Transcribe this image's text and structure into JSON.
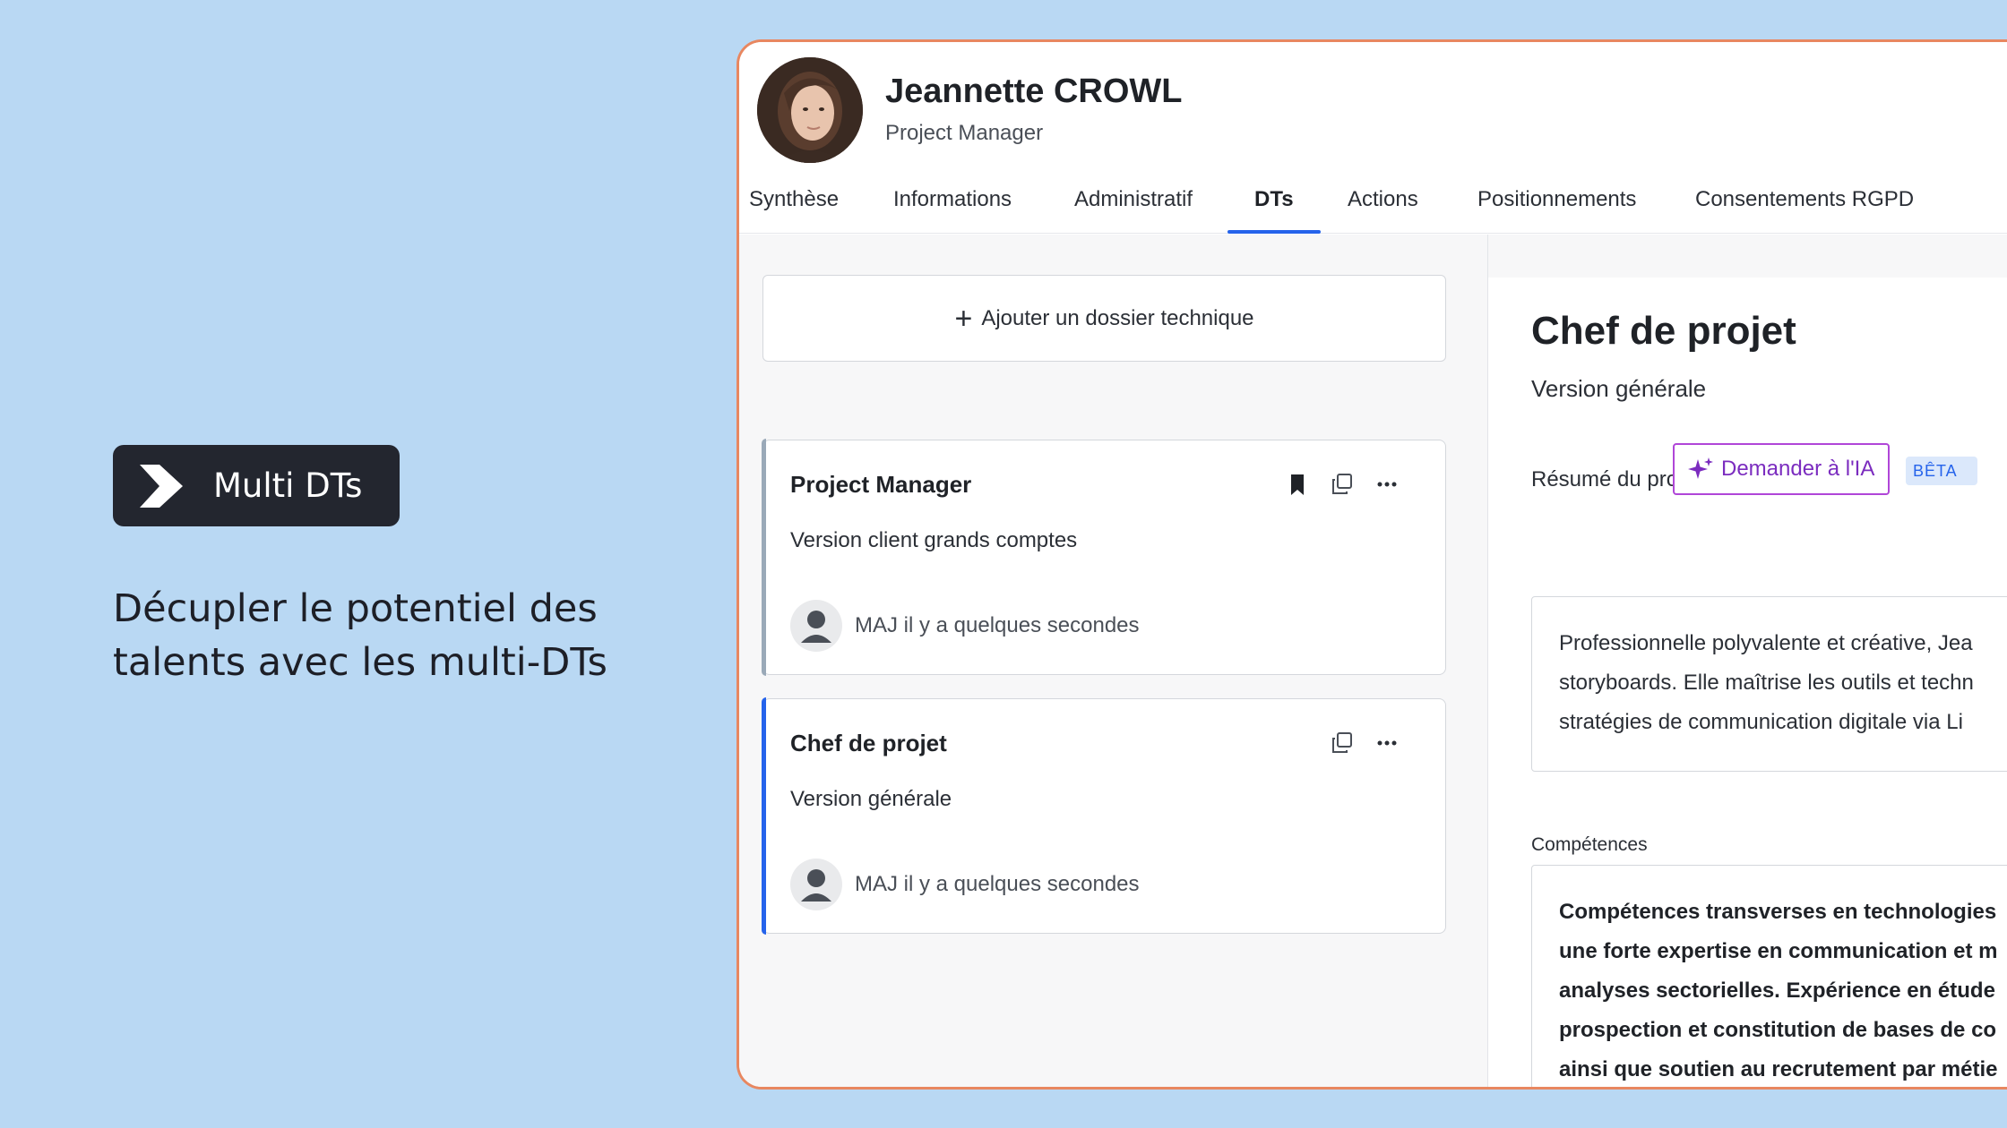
{
  "promo": {
    "badge_label": "Multi DTs",
    "tagline_line1": "Décupler le potentiel des",
    "tagline_line2": "talents avec les multi-DTs"
  },
  "profile": {
    "name": "Jeannette CROWL",
    "role": "Project Manager"
  },
  "tabs": [
    {
      "label": "Synthèse",
      "active": false
    },
    {
      "label": "Informations",
      "active": false
    },
    {
      "label": "Administratif",
      "active": false
    },
    {
      "label": "DTs",
      "active": true
    },
    {
      "label": "Actions",
      "active": false
    },
    {
      "label": "Positionnements",
      "active": false
    },
    {
      "label": "Consentements RGPD",
      "active": false
    }
  ],
  "add_dossier": {
    "label": "Ajouter un dossier technique"
  },
  "cards": [
    {
      "title": "Project Manager",
      "subtitle": "Version client grands comptes",
      "updated": "MAJ il y a quelques secondes",
      "bookmarked": true
    },
    {
      "title": "Chef de projet",
      "subtitle": "Version générale",
      "updated": "MAJ il y a quelques secondes",
      "bookmarked": false
    }
  ],
  "detail": {
    "title": "Chef de projet",
    "version": "Version générale",
    "resume_label": "Résumé du profil",
    "ai_button": "Demander à l'IA",
    "beta_badge": "BÊTA",
    "summary_lines": [
      "Professionnelle polyvalente et créative, Jea",
      "storyboards. Elle maîtrise les outils et techn",
      "stratégies de communication digitale via Li"
    ],
    "skills_label": "Compétences",
    "skills_lines": [
      "Compétences transverses en technologies",
      "une forte expertise en communication et m",
      "analyses sectorielles. Expérience en étude",
      "prospection et constitution de bases de co",
      "ainsi que soutien au recrutement par métie"
    ]
  },
  "colors": {
    "background": "#b9d8f3",
    "accent": "#2563eb",
    "window_border": "#e88760",
    "ai_purple": "#b046d8"
  }
}
